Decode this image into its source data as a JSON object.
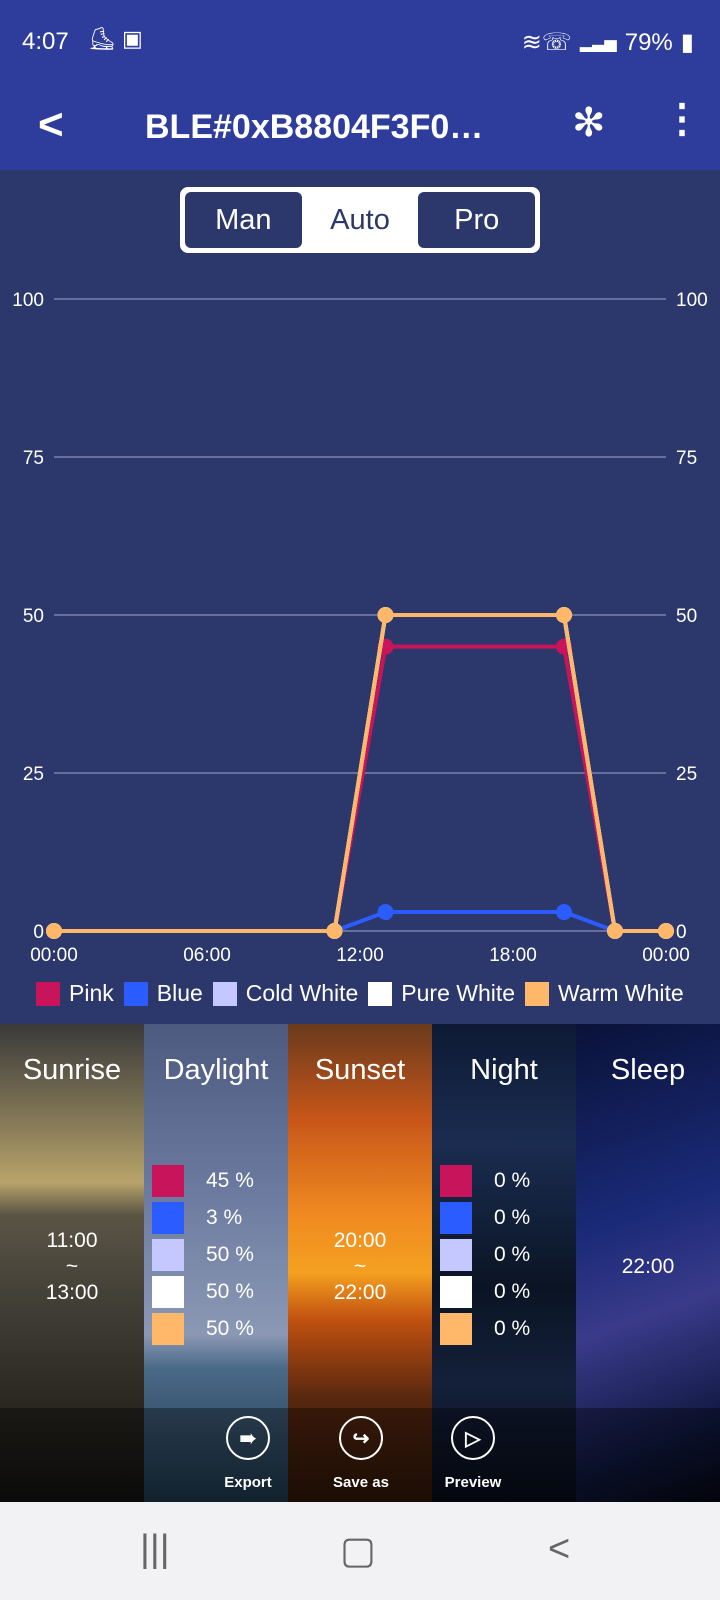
{
  "status": {
    "time": "4:07",
    "battery": "79%",
    "icons": [
      "notification-icon",
      "puzzle-icon",
      "wifi-calling-icon",
      "signal-icon",
      "battery-icon"
    ]
  },
  "appbar": {
    "title": "BLE#0xB8804F3F0…"
  },
  "modes": [
    {
      "label": "Man",
      "selected": false
    },
    {
      "label": "Auto",
      "selected": true
    },
    {
      "label": "Pro",
      "selected": false
    }
  ],
  "chart_data": {
    "type": "line",
    "x_ticks": [
      "00:00",
      "06:00",
      "12:00",
      "18:00",
      "00:00"
    ],
    "y_ticks": [
      "0",
      "25",
      "50",
      "75",
      "100"
    ],
    "ylim": [
      0,
      100
    ],
    "xlim_hours": [
      0,
      24
    ],
    "grid": true,
    "legend_position": "bottom",
    "x_hours": [
      0,
      11,
      13,
      20,
      22,
      24
    ],
    "series": [
      {
        "name": "Blue",
        "color": "#2a5cff",
        "values": [
          0,
          0,
          3,
          3,
          0,
          0
        ]
      },
      {
        "name": "Pink",
        "color": "#c8145a",
        "values": [
          0,
          0,
          45,
          45,
          0,
          0
        ]
      },
      {
        "name": "Cold White",
        "color": "#c5c8ff",
        "values": [
          0,
          0,
          50,
          50,
          0,
          0
        ]
      },
      {
        "name": "Pure White",
        "color": "#ffffff",
        "values": [
          0,
          0,
          50,
          50,
          0,
          0
        ]
      },
      {
        "name": "Warm White",
        "color": "#ffb86a",
        "values": [
          0,
          0,
          50,
          50,
          0,
          0
        ]
      }
    ]
  },
  "legend": [
    {
      "name": "Pink",
      "color": "#c8145a"
    },
    {
      "name": "Blue",
      "color": "#2a5cff"
    },
    {
      "name": "Cold White",
      "color": "#c5c8ff"
    },
    {
      "name": "Pure White",
      "color": "#ffffff"
    },
    {
      "name": "Warm White",
      "color": "#ffb86a"
    }
  ],
  "panels": {
    "sunrise": {
      "name": "Sunrise",
      "start": "11:00",
      "sep": "~",
      "end": "13:00"
    },
    "daylight": {
      "name": "Daylight",
      "values": [
        "45 %",
        "3 %",
        "50 %",
        "50 %",
        "50 %"
      ]
    },
    "sunset": {
      "name": "Sunset",
      "start": "20:00",
      "sep": "~",
      "end": "22:00"
    },
    "night": {
      "name": "Night",
      "values": [
        "0 %",
        "0 %",
        "0 %",
        "0 %",
        "0 %"
      ]
    },
    "sleep": {
      "name": "Sleep",
      "time": "22:00"
    }
  },
  "actions": {
    "export": "Export",
    "save_as": "Save as",
    "preview": "Preview"
  }
}
